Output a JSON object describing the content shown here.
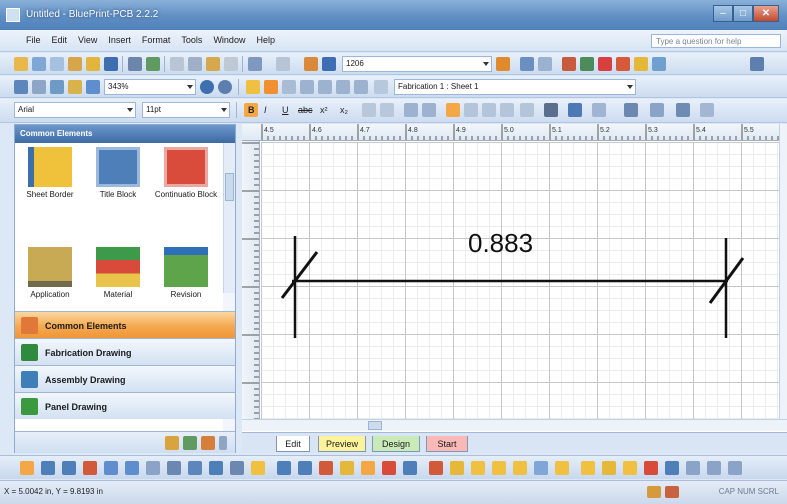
{
  "window": {
    "title": "Untitled - BluePrint-PCB 2.2.2"
  },
  "menu": {
    "items": [
      "File",
      "Edit",
      "View",
      "Insert",
      "Format",
      "Tools",
      "Window",
      "Help"
    ],
    "ask_placeholder": "Type a question for help"
  },
  "toolbar1": {
    "quantity_value": "1206"
  },
  "toolbar2": {
    "zoom_value": "343%",
    "sheet_value": "Fabrication 1 : Sheet 1"
  },
  "toolbar3": {
    "font_value": "Arial",
    "size_value": "11pt",
    "bold_glyph": "B",
    "italic_glyph": "I",
    "underline_glyph": "U",
    "strike_glyph": "abc",
    "superscript_glyph": "x²",
    "subscript_glyph": "x₂"
  },
  "left_panel": {
    "header": "Common Elements",
    "stencils": [
      {
        "label": "Sheet Border",
        "icon": "sheet-border-icon"
      },
      {
        "label": "Title Block",
        "icon": "title-block-icon"
      },
      {
        "label": "Continuatio Block",
        "icon": "continuation-block-icon"
      },
      {
        "label": "Application",
        "icon": "application-block-icon"
      },
      {
        "label": "Material",
        "icon": "material-block-icon"
      },
      {
        "label": "Revision",
        "icon": "revision-block-icon"
      }
    ],
    "nav": [
      {
        "label": "Common Elements",
        "icon": "common-elements-icon"
      },
      {
        "label": "Fabrication Drawing",
        "icon": "fabrication-drawing-icon"
      },
      {
        "label": "Assembly Drawing",
        "icon": "assembly-drawing-icon"
      },
      {
        "label": "Panel Drawing",
        "icon": "panel-drawing-icon"
      }
    ]
  },
  "ruler": {
    "labels": [
      "4.5",
      "4.6",
      "4.7",
      "4.8",
      "4.9",
      "5.0",
      "5.1",
      "5.2",
      "5.3",
      "5.4",
      "5.5"
    ]
  },
  "canvas": {
    "dimension_value": "0.883"
  },
  "tabs": [
    "Edit",
    "Preview",
    "Design",
    "Start"
  ],
  "status": {
    "coords": "X = 5.0042 in, Y = 9.8193 in",
    "indicators": "CAP NUM SCRL"
  },
  "colors": {
    "accent": "#f0953a",
    "title_bar": "#5f8fc4",
    "preview_tab": "#fdf39a",
    "design_tab": "#c9ebb9",
    "start_tab": "#f8b9b7"
  }
}
